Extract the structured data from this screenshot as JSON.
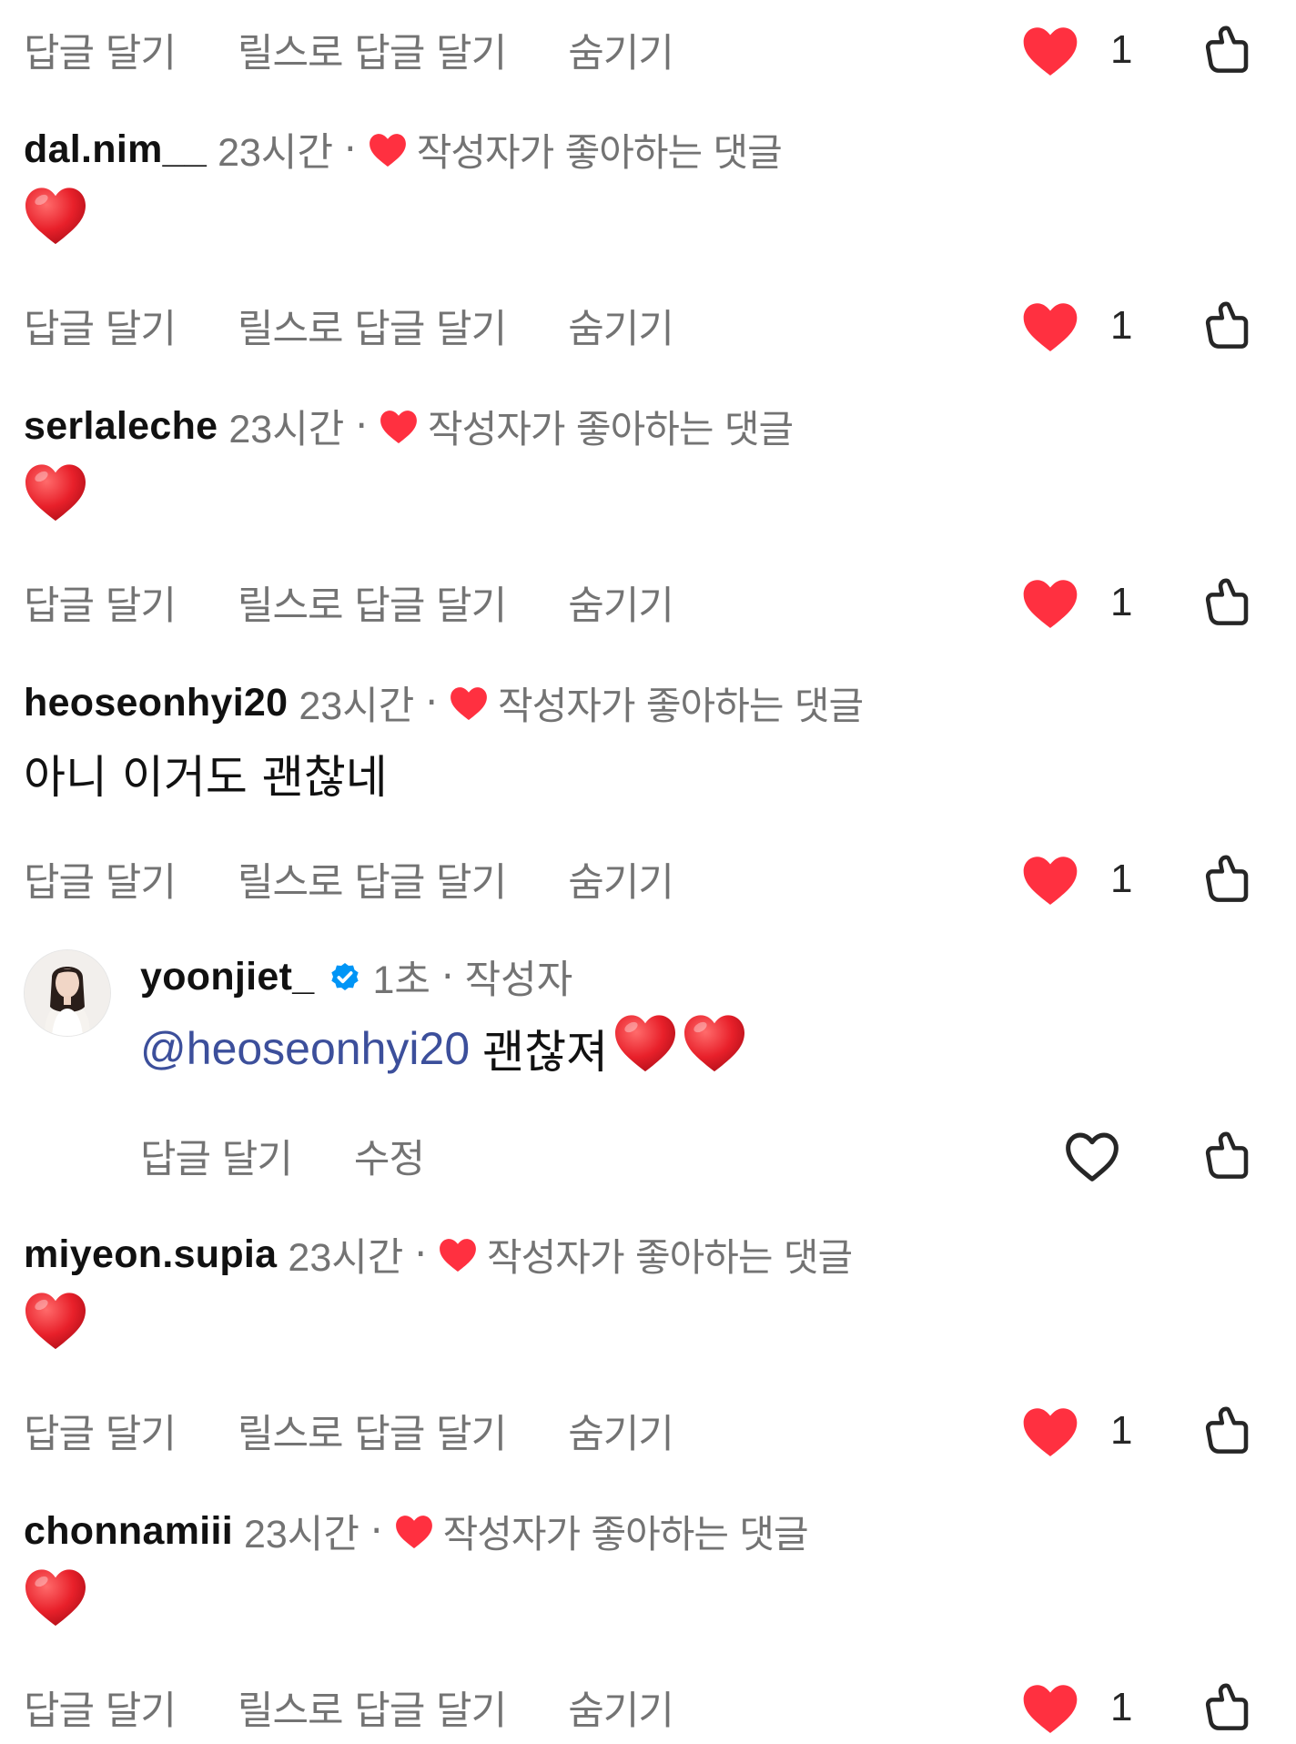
{
  "actions": {
    "reply": "답글 달기",
    "reels_reply": "릴스로 답글 달기",
    "hide": "숨기기",
    "edit": "수정"
  },
  "liked_by_author_label": "작성자가 좋아하는 댓글",
  "comments": [
    {
      "username": "dal.nim__",
      "time": "23시간",
      "body_emoji": "red-heart",
      "likes": "1"
    },
    {
      "username": "serlaleche",
      "time": "23시간",
      "body_emoji": "red-heart",
      "likes": "1"
    },
    {
      "username": "heoseonhyi20",
      "time": "23시간",
      "body_text": "아니 이거도 괜찮네",
      "likes": "1"
    },
    {
      "username": "miyeon.supia",
      "time": "23시간",
      "body_emoji": "red-heart",
      "likes": "1"
    },
    {
      "username": "chonnamiii",
      "time": "23시간",
      "body_emoji": "red-heart",
      "likes": "1"
    }
  ],
  "top_row": {
    "likes": "1"
  },
  "reply": {
    "username": "yoonjiet_",
    "time": "1초",
    "author_label": "작성자",
    "mention": "@heoseonhyi20",
    "text": "괜찮져",
    "verified": true
  },
  "colors": {
    "like_red": "#ff3040",
    "muted_text": "#737373",
    "mention_blue": "#3c4f9b",
    "verified_blue": "#0095f6"
  }
}
